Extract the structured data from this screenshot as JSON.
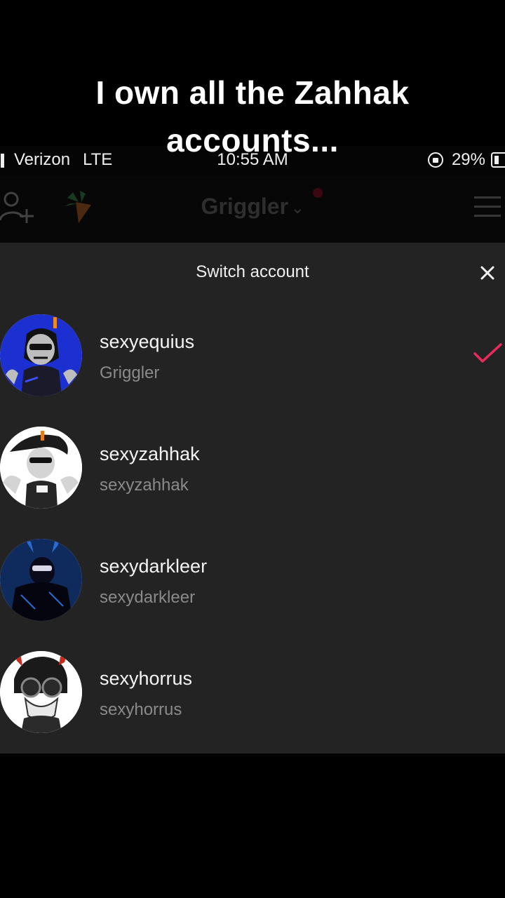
{
  "caption": {
    "line1": "I own all the Zahhak",
    "line2": "accounts..."
  },
  "status_bar": {
    "carrier": "Verizon",
    "network": "LTE",
    "time": "10:55 AM",
    "battery": "29%"
  },
  "app_bar": {
    "title": "Griggler",
    "left_icons": [
      "add-user-icon",
      "carrot-icon"
    ],
    "right_icon": "menu-icon"
  },
  "switch_sheet": {
    "title": "Switch account",
    "close_icon": "close-icon",
    "accent_color": "#ea2a5a",
    "accounts": [
      {
        "username": "sexyequius",
        "nickname": "Griggler",
        "selected": true
      },
      {
        "username": "sexyzahhak",
        "nickname": "sexyzahhak",
        "selected": false
      },
      {
        "username": "sexydarkleer",
        "nickname": "sexydarkleer",
        "selected": false
      },
      {
        "username": "sexyhorrus",
        "nickname": "sexyhorrus",
        "selected": false
      }
    ]
  }
}
